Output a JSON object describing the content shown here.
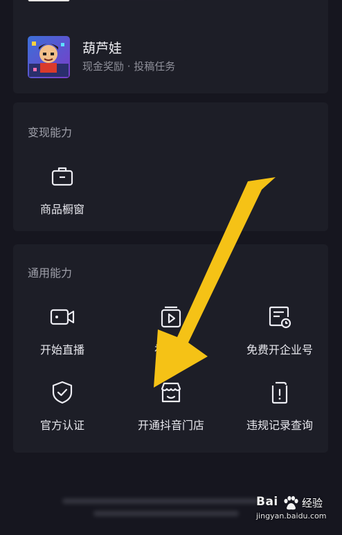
{
  "top_card": {
    "program": {
      "title": "葫芦娃",
      "subtitle": "现金奖励 · 投稿任务"
    }
  },
  "monetization": {
    "title": "变现能力",
    "items": [
      {
        "label": "商品橱窗",
        "icon": "briefcase-icon"
      }
    ]
  },
  "general": {
    "title": "通用能力",
    "items": [
      {
        "label": "开始直播",
        "icon": "live-camera-icon"
      },
      {
        "label": "视频…",
        "icon": "play-video-icon"
      },
      {
        "label": "免费开企业号",
        "icon": "enterprise-clock-icon"
      },
      {
        "label": "官方认证",
        "icon": "shield-check-icon"
      },
      {
        "label": "开通抖音门店",
        "icon": "storefront-icon"
      },
      {
        "label": "违规记录查询",
        "icon": "violation-record-icon"
      }
    ]
  },
  "watermark": {
    "brand": "Bai",
    "suffix": "经验",
    "url": "jingyan.baidu.com"
  },
  "colors": {
    "background": "#16161f",
    "card": "#1d1e27",
    "arrow": "#f5c216"
  }
}
